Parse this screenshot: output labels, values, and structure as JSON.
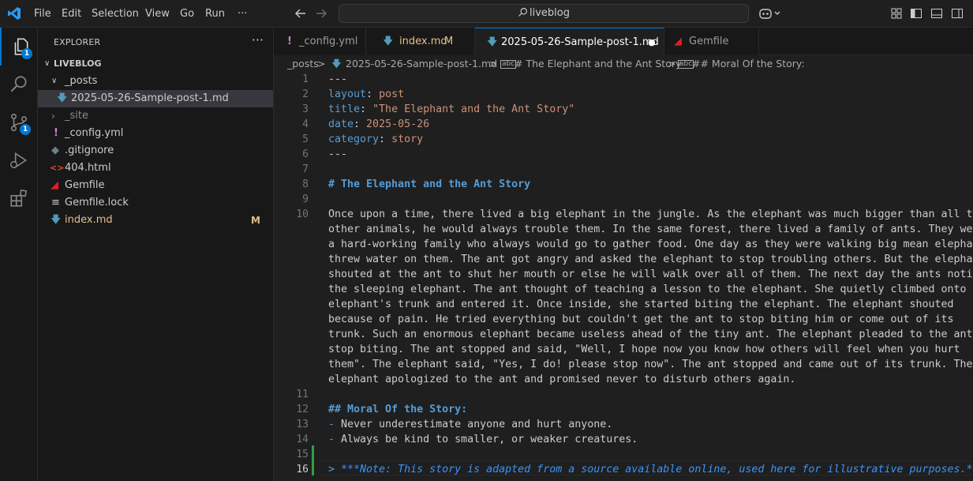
{
  "menu": [
    "File",
    "Edit",
    "Selection",
    "View",
    "Go",
    "Run",
    "···"
  ],
  "search": {
    "text": "liveblog"
  },
  "activity_badges": {
    "explorer": "1",
    "scm": "1"
  },
  "sidebar": {
    "title": "EXPLORER",
    "more": "···",
    "root": "LIVEBLOG",
    "items": [
      {
        "label": "_posts",
        "icon": "chevron-down-icon"
      },
      {
        "label": "2025-05-26-Sample-post-1.md",
        "icon": "markdown-icon"
      },
      {
        "label": "_site",
        "icon": "chevron-right-icon"
      },
      {
        "label": "_config.yml",
        "icon": "yaml-icon"
      },
      {
        "label": ".gitignore",
        "icon": "git-icon"
      },
      {
        "label": "404.html",
        "icon": "html-icon"
      },
      {
        "label": "Gemfile",
        "icon": "ruby-icon"
      },
      {
        "label": "Gemfile.lock",
        "icon": "lines-icon"
      },
      {
        "label": "index.md",
        "icon": "markdown-icon",
        "git_status": "M"
      }
    ]
  },
  "tabs": [
    {
      "label": "_config.yml",
      "icon": "yaml-icon"
    },
    {
      "label": "index.md",
      "icon": "markdown-icon",
      "status": "M"
    },
    {
      "label": "2025-05-26-Sample-post-1.md",
      "icon": "markdown-icon",
      "active": true,
      "dirty": "●"
    },
    {
      "label": "Gemfile",
      "icon": "ruby-icon"
    }
  ],
  "breadcrumb": [
    "_posts",
    ">",
    "2025-05-26-Sample-post-1.md",
    ">",
    "# The Elephant and the Ant Story",
    ">",
    "## Moral Of the Story:"
  ],
  "editor": {
    "line_numbers": [
      "1",
      "2",
      "3",
      "4",
      "5",
      "6",
      "7",
      "8",
      "9",
      "10",
      "11",
      "12",
      "13",
      "14",
      "15",
      "16"
    ],
    "lines": {
      "l1": "---",
      "l2_key": "layout",
      "l2_colon": ": ",
      "l2_val": "post",
      "l3_key": "title",
      "l3_colon": ": ",
      "l3_val": "\"The Elephant and the Ant Story\"",
      "l4_key": "date",
      "l4_colon": ": ",
      "l4_val": "2025-05-26",
      "l5_key": "category",
      "l5_colon": ": ",
      "l5_val": "story",
      "l6": "---",
      "l8": "# The Elephant and the Ant Story",
      "l10": [
        "Once upon a time, there lived a big elephant in the jungle. As the elephant was much bigger than all the",
        "other animals, he would always trouble them. In the same forest, there lived a family of ants. They were",
        "a hard-working family who always would go to gather food. One day as they were walking big mean elephant",
        "threw water on them. The ant got angry and asked the elephant to stop troubling others. But the elephant",
        "shouted at the ant to shut her mouth or else he will walk over all of them. The next day the ants noticed",
        "the sleeping elephant. The ant thought of teaching a lesson to the elephant. She quietly climbed onto the",
        "elephant's trunk and entered it. Once inside, she started biting the elephant. The elephant shouted",
        "because of pain. He tried everything but couldn't get the ant to stop biting him or come out of its",
        "trunk. Such an enormous elephant became useless ahead of the tiny ant. The elephant pleaded to the ant to",
        "stop biting. The ant stopped and said, \"Well, I hope now you know how others will feel when you hurt",
        "them\". The elephant said, \"Yes, I do! please stop now\". The ant stopped and came out of its trunk. The",
        "elephant apologized to the ant and promised never to disturb others again."
      ],
      "l12": "## Moral Of the Story:",
      "l13_dash": "- ",
      "l13": "Never underestimate anyone and hurt anyone.",
      "l14_dash": "- ",
      "l14": "Always be kind to smaller, or weaker creatures.",
      "l16_mark": "> ",
      "l16": "***Note: This story is adapted from a source available online, used here for illustrative purposes.***"
    }
  }
}
